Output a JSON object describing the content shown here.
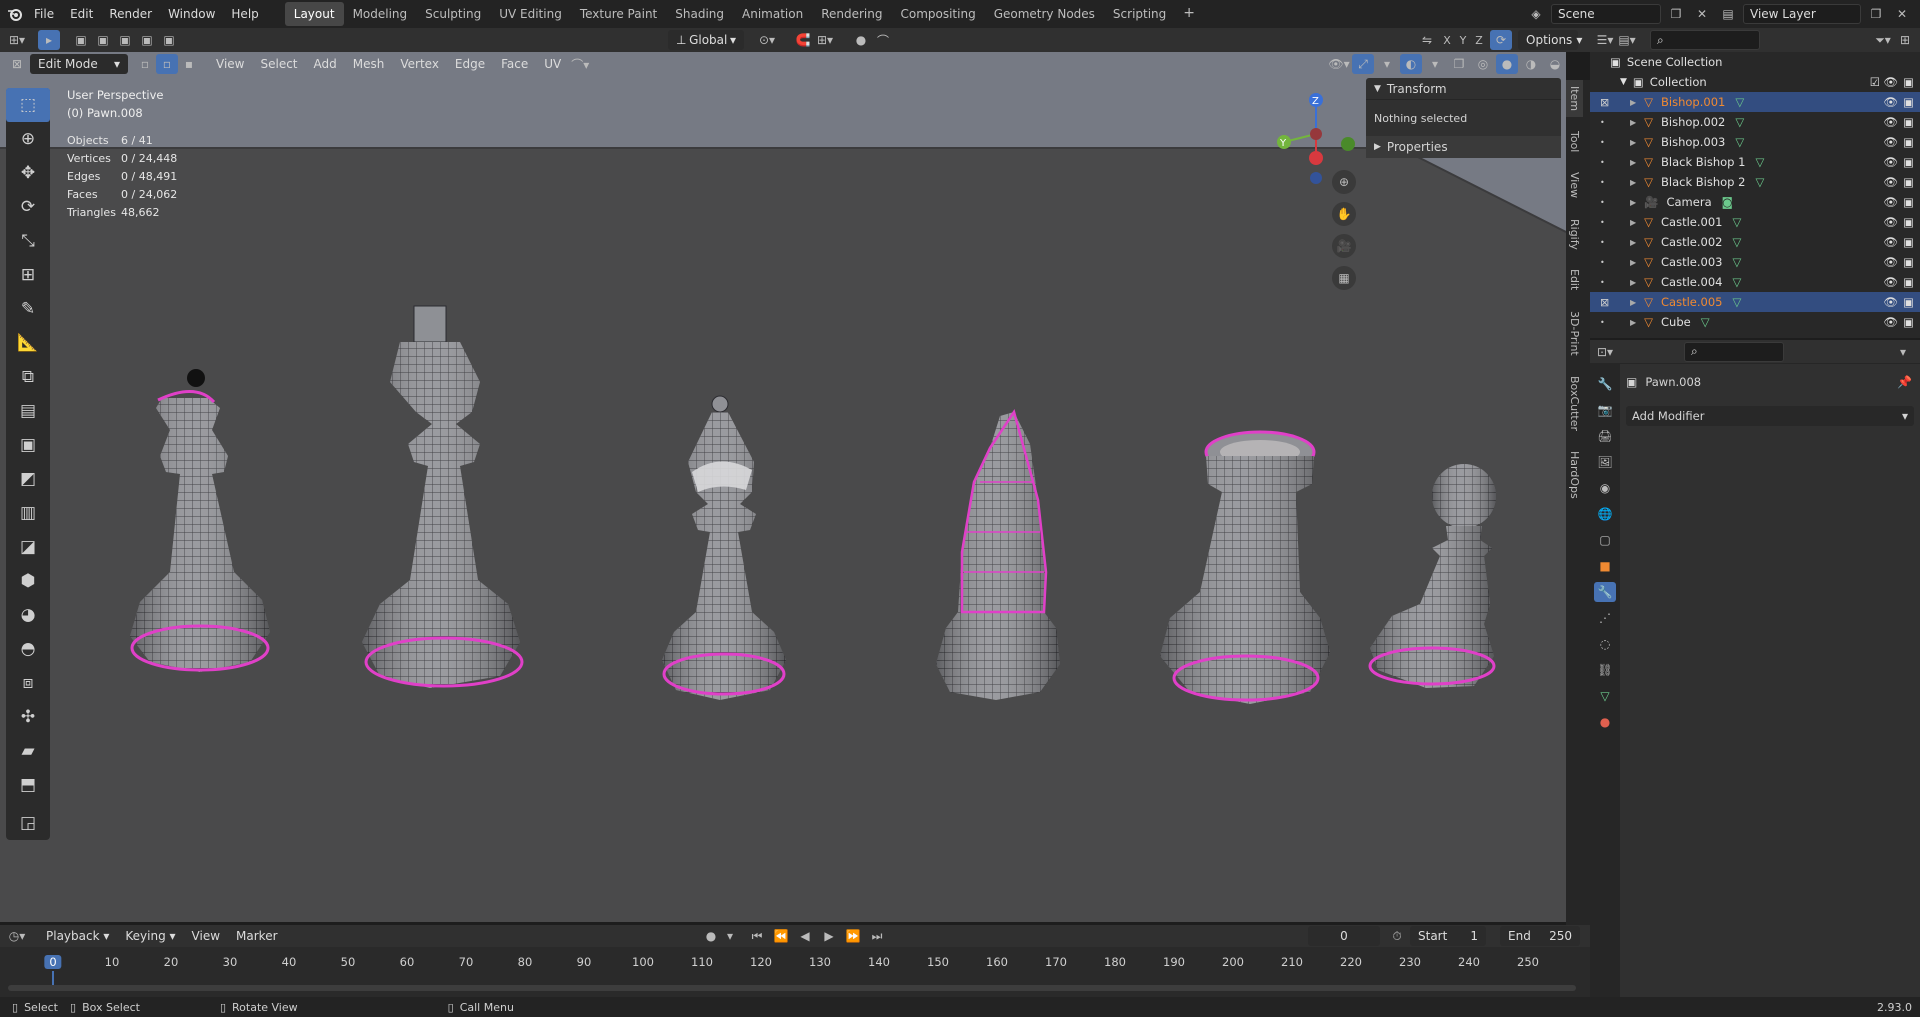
{
  "topbar": {
    "menus": [
      "File",
      "Edit",
      "Render",
      "Window",
      "Help"
    ],
    "workspaces": [
      "Layout",
      "Modeling",
      "Sculpting",
      "UV Editing",
      "Texture Paint",
      "Shading",
      "Animation",
      "Rendering",
      "Compositing",
      "Geometry Nodes",
      "Scripting"
    ],
    "active_workspace": "Layout",
    "scene": "Scene",
    "view_layer": "View Layer"
  },
  "viewport_header": {
    "mode": "Edit Mode",
    "menus": [
      "View",
      "Select",
      "Add",
      "Mesh",
      "Vertex",
      "Edge",
      "Face",
      "UV"
    ],
    "transform_orientation": "Global",
    "options_label": "Options",
    "axes": [
      "X",
      "Y",
      "Z"
    ]
  },
  "overlay": {
    "view_name": "User Perspective",
    "object_name": "(0) Pawn.008",
    "stats": [
      {
        "k": "Objects",
        "v": "6 / 41"
      },
      {
        "k": "Vertices",
        "v": "0 / 24,448"
      },
      {
        "k": "Edges",
        "v": "0 / 48,491"
      },
      {
        "k": "Faces",
        "v": "0 / 24,062"
      },
      {
        "k": "Triangles",
        "v": "48,662"
      }
    ]
  },
  "gizmo": {
    "z": "Z",
    "y": "Y"
  },
  "npanel": {
    "transform_label": "Transform",
    "nothing_selected": "Nothing selected",
    "properties_label": "Properties",
    "tabs": [
      "Item",
      "Tool",
      "View",
      "Rigify",
      "Edit",
      "3D-Print",
      "BoxCutter",
      "HardOps"
    ]
  },
  "outliner": {
    "scene_collection": "Scene Collection",
    "collection": "Collection",
    "items": [
      {
        "name": "Bishop.001",
        "selected": true,
        "orange": true
      },
      {
        "name": "Bishop.002",
        "selected": false,
        "orange": false
      },
      {
        "name": "Bishop.003",
        "selected": false,
        "orange": false
      },
      {
        "name": "Black Bishop 1",
        "selected": false,
        "orange": false
      },
      {
        "name": "Black Bishop 2",
        "selected": false,
        "orange": false
      },
      {
        "name": "Camera",
        "selected": false,
        "orange": false
      },
      {
        "name": "Castle.001",
        "selected": false,
        "orange": false
      },
      {
        "name": "Castle.002",
        "selected": false,
        "orange": false
      },
      {
        "name": "Castle.003",
        "selected": false,
        "orange": false
      },
      {
        "name": "Castle.004",
        "selected": false,
        "orange": false
      },
      {
        "name": "Castle.005",
        "selected": true,
        "orange": true
      },
      {
        "name": "Cube",
        "selected": false,
        "orange": false
      }
    ]
  },
  "properties": {
    "object_name": "Pawn.008",
    "add_modifier": "Add Modifier"
  },
  "timeline": {
    "menus": [
      "Playback",
      "Keying",
      "View",
      "Marker"
    ],
    "current_frame": "0",
    "start_label": "Start",
    "start": "1",
    "end_label": "End",
    "end": "250",
    "ticks": [
      "0",
      "10",
      "20",
      "30",
      "40",
      "50",
      "60",
      "70",
      "80",
      "90",
      "100",
      "110",
      "120",
      "130",
      "140",
      "150",
      "160",
      "170",
      "180",
      "190",
      "200",
      "210",
      "220",
      "230",
      "240",
      "250"
    ]
  },
  "statusbar": {
    "select": "Select",
    "box_select": "Box Select",
    "rotate_view": "Rotate View",
    "call_menu": "Call Menu",
    "version": "2.93.0"
  },
  "colors": {
    "accent": "#4772b3",
    "edge_highlight": "#e040c8",
    "orange": "#f08a32"
  }
}
